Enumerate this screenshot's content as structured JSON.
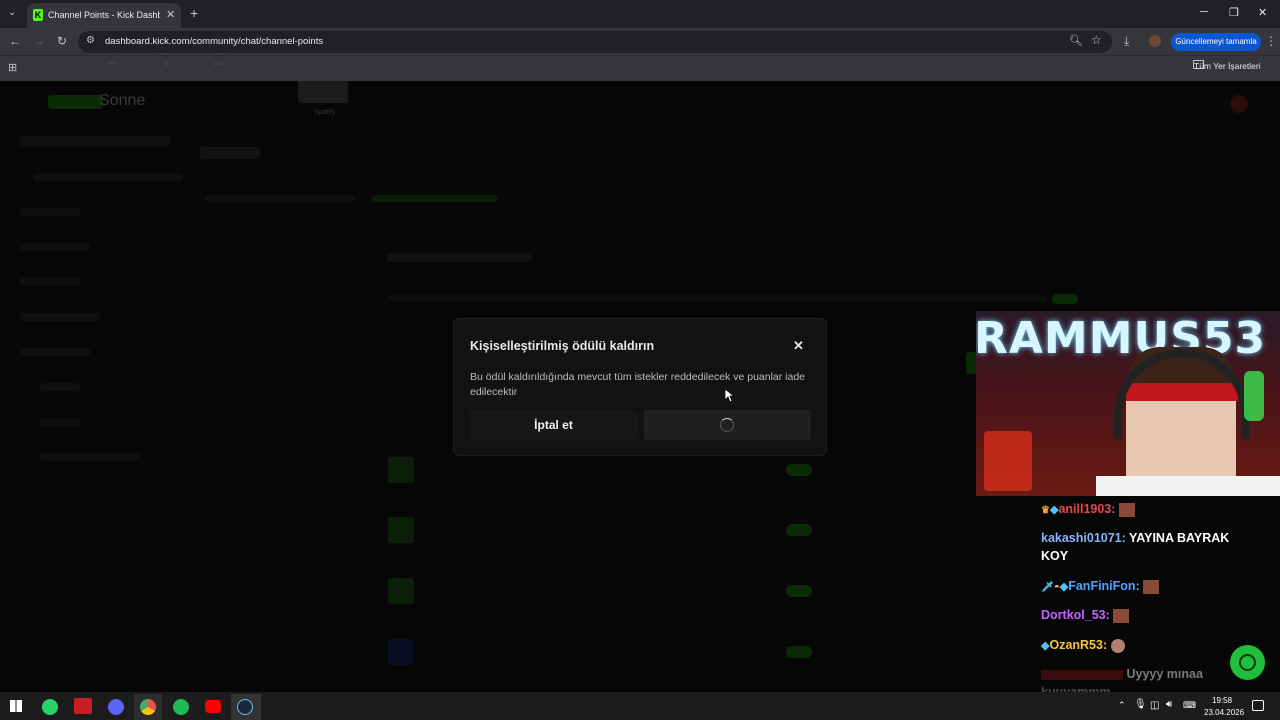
{
  "browser": {
    "tab_title": "Channel Points - Kick Dashboard",
    "tab_favicon": "K",
    "url": "dashboard.kick.com/community/chat/channel-points",
    "update_button": "Güncellemeyi tamamla",
    "bookmarks_all": "Tüm Yer İşaretleri"
  },
  "background": {
    "now_playing": "Sonne",
    "player_source": "Spotify"
  },
  "modal": {
    "title": "Kişiselleştirilmiş ödülü kaldırın",
    "body": "Bu ödül kaldırıldığında mevcut tüm istekler reddedilecek ve puanlar iade edilecektir",
    "cancel_label": "İptal et",
    "confirm_state": "loading"
  },
  "stream_overlay": {
    "banner_text": "RAMMUS53",
    "chat": [
      {
        "user": "anill1903:",
        "user_color": "#e5484d",
        "message": "",
        "badges": [
          "crown-icon",
          "cube-icon"
        ],
        "emote": "emote-icon"
      },
      {
        "user": "kakashi01071:",
        "user_color": "#8ab4f8",
        "message": "YAYINA BAYRAK",
        "message_cont": "KOY"
      },
      {
        "user": "FanFiniFon:",
        "user_color": "#4fa3ff",
        "message": "",
        "badges": [
          "sword-icon",
          "glasses-icon",
          "cube-icon"
        ],
        "emote": "emote-icon"
      },
      {
        "user": "Dortkol_53:",
        "user_color": "#c264ff",
        "message": "",
        "emote": "emote-icon"
      },
      {
        "user": "OzanR53:",
        "user_color": "#f5c542",
        "message": "",
        "badges": [
          "cube-icon"
        ],
        "emote": "emote-icon"
      },
      {
        "user": "",
        "user_color": "#e5484d",
        "message": "Uyyyy mınaa",
        "message_cont": "kuuyammm"
      }
    ]
  },
  "taskbar": {
    "time": "19:58",
    "date": "23.04.2026"
  }
}
